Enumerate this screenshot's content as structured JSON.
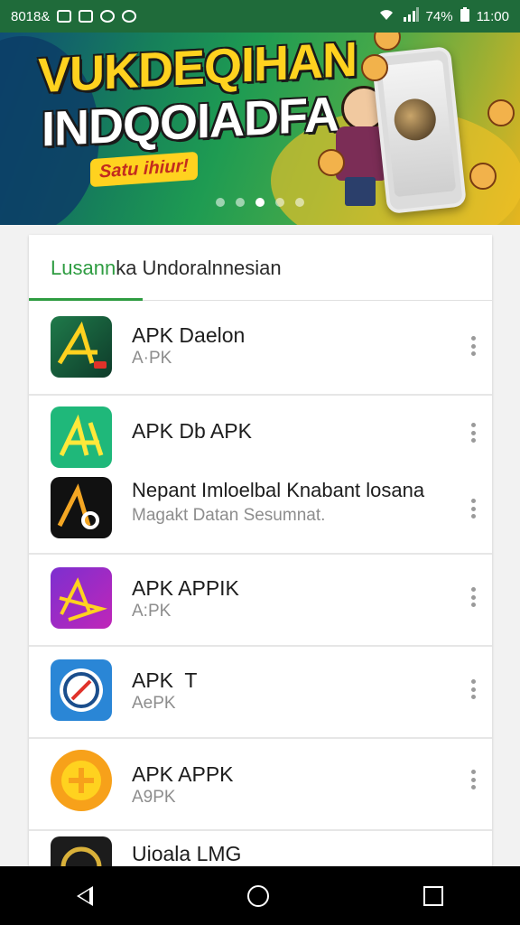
{
  "status_bar": {
    "left_text": "8018&",
    "battery": "74%",
    "time": "11:00"
  },
  "banner": {
    "title_line1": "VUKDEQIHAN",
    "title_line2": "INDQOIADFA",
    "subtitle": "Satu ihiur!",
    "page_count": 5,
    "active_page": 3
  },
  "section": {
    "title_accent": "Lusann",
    "title_rest": "ka Undoralnnesian"
  },
  "apps": [
    {
      "name": "APK Daelon",
      "sub": "A·PK"
    },
    {
      "name": "APK Db APK",
      "sub": ""
    },
    {
      "name": "Nepant Imloelbal Knabant losana",
      "sub": "Magakt Datan Sesumnat."
    },
    {
      "name": "APK APPIK",
      "sub": "A:PK"
    },
    {
      "name": "APK  T",
      "sub": "AePK"
    },
    {
      "name": "APK APPK",
      "sub": "A9PK"
    },
    {
      "name": "Uioala LMG",
      "sub": ""
    }
  ],
  "colors": {
    "accent_green": "#2e9c41",
    "status_bar": "#1f6b3a",
    "nav_bar": "#000000"
  }
}
